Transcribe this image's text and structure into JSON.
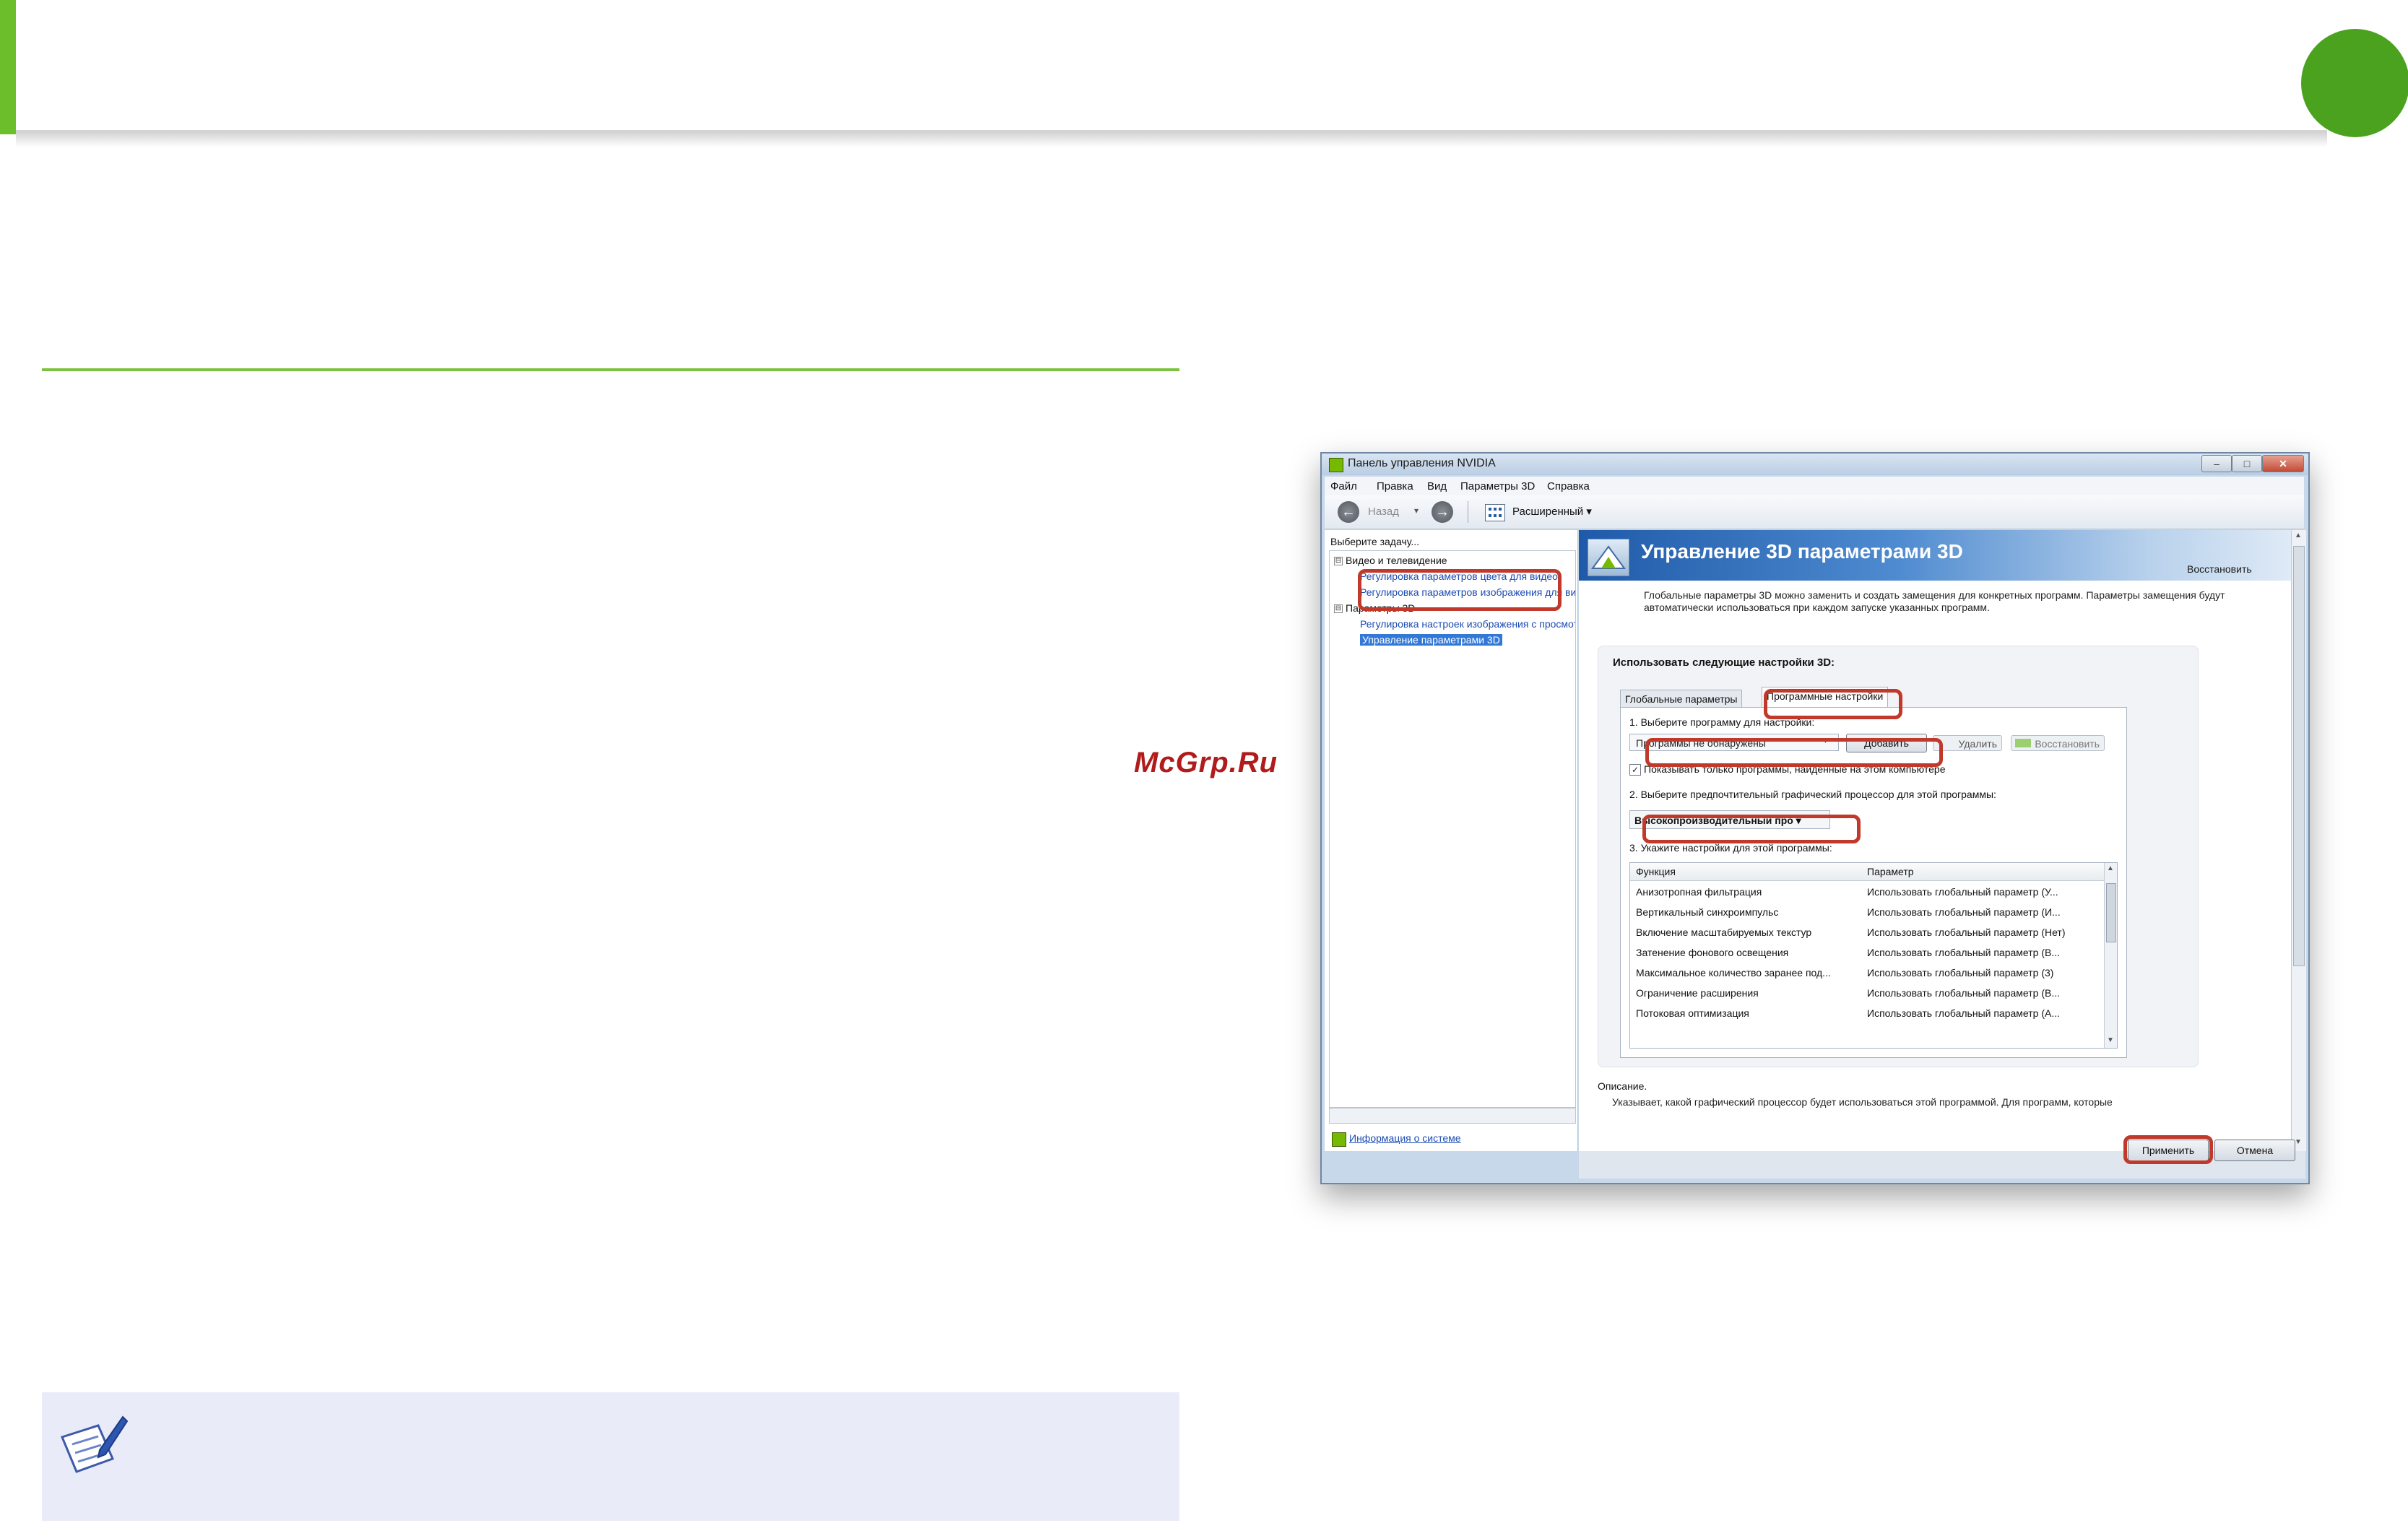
{
  "page": {
    "accent_green": "#6cbf2a",
    "highlight_color": "#c0392b",
    "watermark": "McGrp.Ru"
  },
  "window": {
    "title": "Панель управления NVIDIA",
    "controls": {
      "minimize": "–",
      "maximize": "□",
      "close": "✕"
    },
    "menu": [
      "Файл",
      "Правка",
      "Вид",
      "Параметры 3D",
      "Справка"
    ],
    "toolbar": {
      "back_label": "Назад",
      "back_icon": "arrow-left-icon",
      "forward_icon": "arrow-right-icon",
      "view_label": "Расширенный ▾"
    }
  },
  "left_pane": {
    "task_label": "Выберите задачу...",
    "tree": [
      {
        "label": "Видео и телевидение",
        "type": "category",
        "expander": "⊟"
      },
      {
        "label": "Регулировка параметров цвета для видео",
        "type": "link"
      },
      {
        "label": "Регулировка параметров изображения для видео",
        "type": "link"
      },
      {
        "label": "Параметры 3D",
        "type": "category",
        "expander": "⊟"
      },
      {
        "label": "Регулировка настроек изображения с просмотром",
        "type": "link"
      },
      {
        "label": "Управление параметрами 3D",
        "type": "link",
        "selected": true
      }
    ],
    "system_info": "Информация о системе"
  },
  "right_pane": {
    "title": "Управление 3D параметрами 3D",
    "restore": "Восстановить",
    "description": "Глобальные параметры 3D можно заменить и создать замещения для конкретных программ. Параметры замещения будут автоматически использоваться при каждом запуске указанных программ.",
    "settings_label": "Использовать следующие настройки 3D:",
    "tabs": [
      {
        "label": "Глобальные параметры",
        "active": false
      },
      {
        "label": "Программные настройки",
        "active": true
      }
    ],
    "step1": "1. Выберите программу для настройки:",
    "program_select": "Программы не обнаружены",
    "add_button": "Добавить",
    "remove_button": "Удалить",
    "restore_button": "Восстановить",
    "checkbox_label": "Показывать только программы, найденные на этом компьютере",
    "checkbox_checked": true,
    "step2": "2. Выберите предпочтительный графический процессор для этой программы:",
    "gpu_select": "Высокопроизводительный про ▾",
    "step3": "3. Укажите настройки для этой программы:",
    "list_columns": [
      "Функция",
      "Параметр"
    ],
    "list_rows": [
      {
        "function": "Анизотропная фильтрация",
        "param": "Использовать глобальный параметр (У..."
      },
      {
        "function": "Вертикальный синхроимпульс",
        "param": "Использовать глобальный параметр (И..."
      },
      {
        "function": "Включение масштабируемых текстур",
        "param": "Использовать глобальный параметр (Нет)"
      },
      {
        "function": "Затенение фонового освещения",
        "param": "Использовать глобальный параметр (В..."
      },
      {
        "function": "Максимальное количество заранее под...",
        "param": "Использовать глобальный параметр (3)"
      },
      {
        "function": "Ограничение расширения",
        "param": "Использовать глобальный параметр (В..."
      },
      {
        "function": "Потоковая оптимизация",
        "param": "Использовать глобальный параметр (А..."
      }
    ],
    "desc_label": "Описание.",
    "desc_text": "Указывает, какой графический процессор будет использоваться этой программой. Для программ, которые",
    "apply_button": "Применить",
    "cancel_button": "Отмена"
  }
}
